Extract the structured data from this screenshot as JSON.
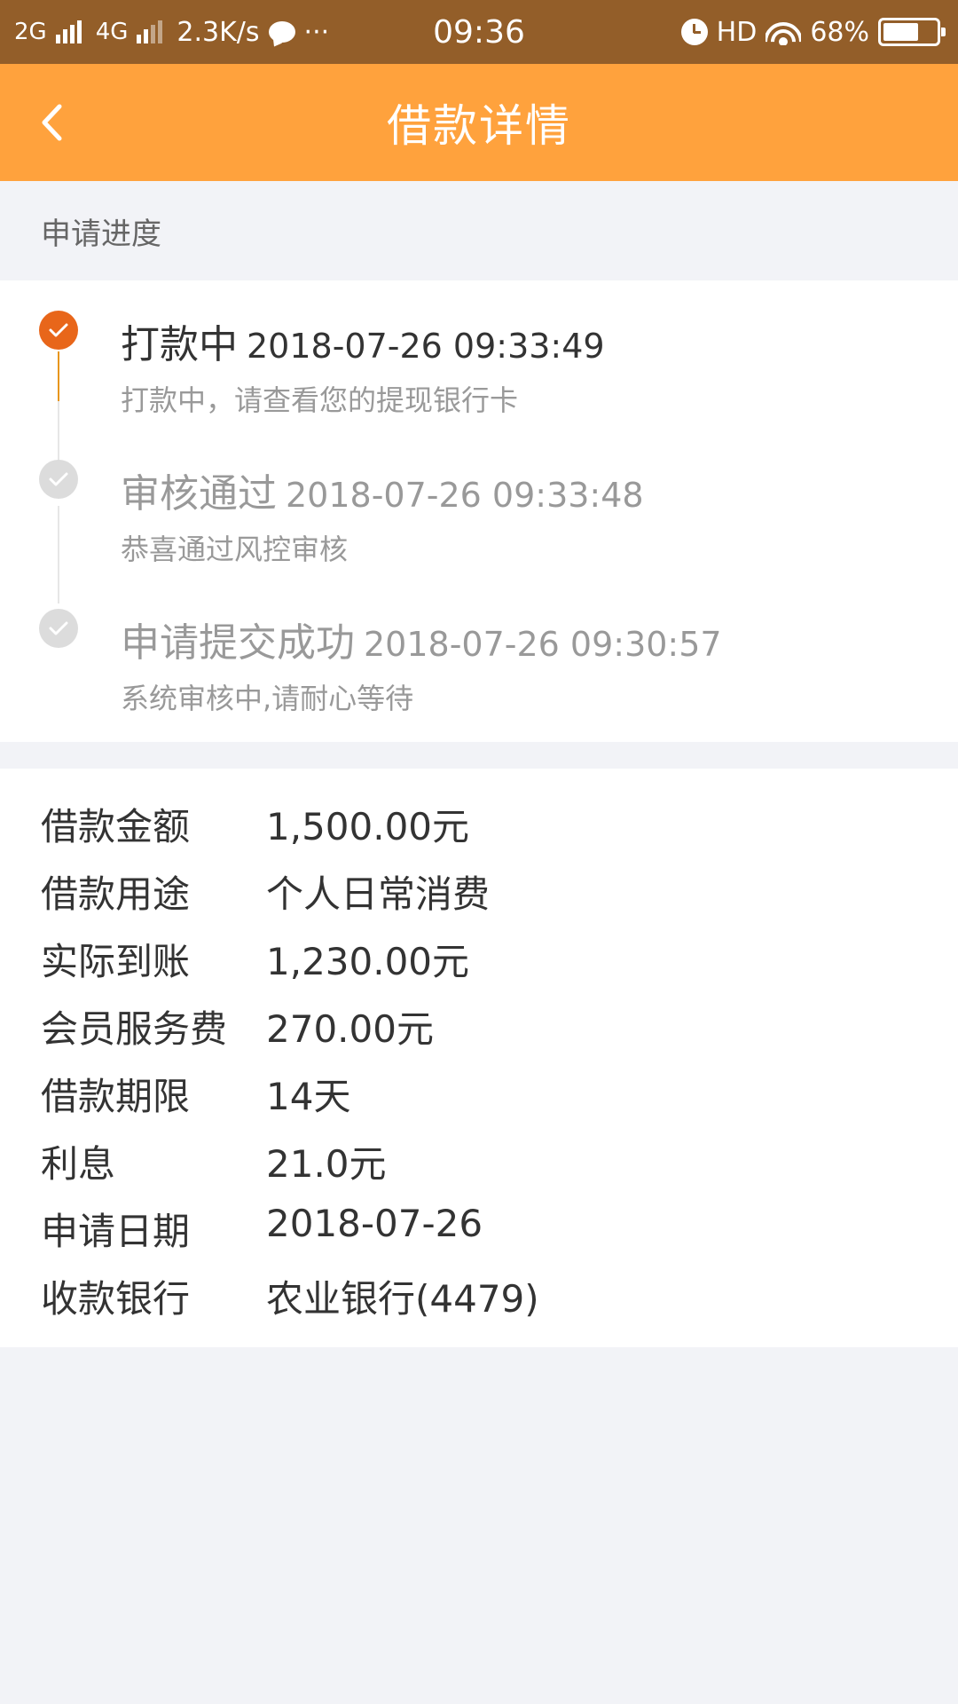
{
  "status_bar": {
    "network_2g": "2G",
    "network_4g": "4G",
    "speed": "2.3K/s",
    "more": "···",
    "time": "09:36",
    "hd": "HD",
    "battery": "68%",
    "battery_level": 0.68
  },
  "header": {
    "title": "借款详情",
    "back_icon": "chevron-left-icon"
  },
  "progress_section": {
    "title": "申请进度",
    "accent_color": "#e8661a",
    "inactive_color": "#dcdcdc",
    "items": [
      {
        "title": "打款中",
        "time": "2018-07-26 09:33:49",
        "desc": "打款中，请查看您的提现银行卡",
        "active": true
      },
      {
        "title": "审核通过",
        "time": "2018-07-26 09:33:48",
        "desc": "恭喜通过风控审核",
        "active": false
      },
      {
        "title": "申请提交成功",
        "time": "2018-07-26 09:30:57",
        "desc": "系统审核中,请耐心等待",
        "active": false
      }
    ]
  },
  "details": [
    {
      "label": "借款金额",
      "value": "1,500.00元"
    },
    {
      "label": "借款用途",
      "value": "个人日常消费"
    },
    {
      "label": "实际到账",
      "value": "1,230.00元"
    },
    {
      "label": "会员服务费",
      "value": "270.00元"
    },
    {
      "label": "借款期限",
      "value": "14天"
    },
    {
      "label": "利息",
      "value": "21.0元"
    },
    {
      "label": "申请日期",
      "value": "2018-07-26"
    },
    {
      "label": "收款银行",
      "value": "农业银行(4479)"
    }
  ]
}
